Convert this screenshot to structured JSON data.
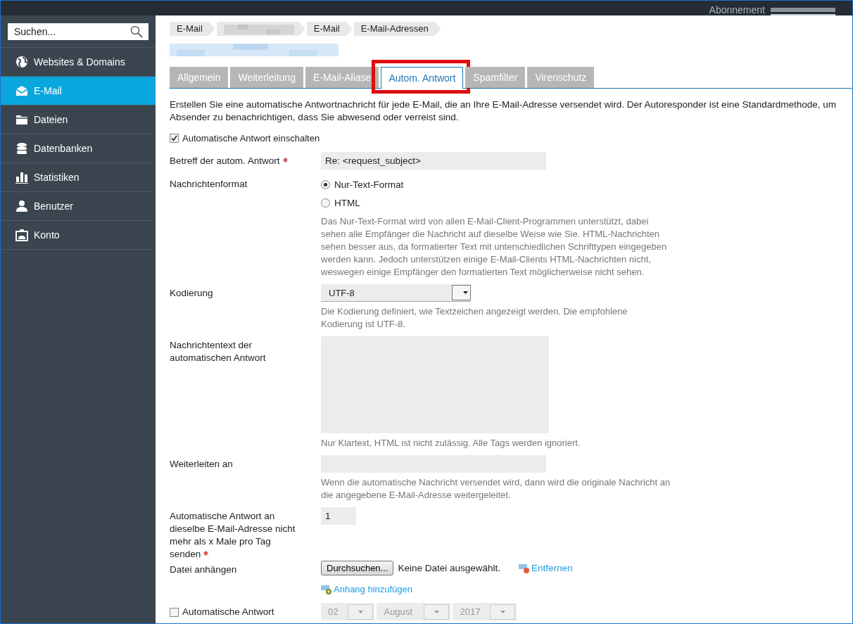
{
  "header": {
    "subscription_label": "Abonnement"
  },
  "sidebar": {
    "search": {
      "placeholder": "Suchen..."
    },
    "items": [
      {
        "label": "Websites & Domains",
        "selected": false
      },
      {
        "label": "E-Mail",
        "selected": true
      },
      {
        "label": "Dateien",
        "selected": false
      },
      {
        "label": "Datenbanken",
        "selected": false
      },
      {
        "label": "Statistiken",
        "selected": false
      },
      {
        "label": "Benutzer",
        "selected": false
      },
      {
        "label": "Konto",
        "selected": false
      }
    ]
  },
  "breadcrumbs": [
    {
      "kind": "text",
      "label": "E-Mail"
    },
    {
      "kind": "redacted"
    },
    {
      "kind": "text",
      "label": "E-Mail"
    },
    {
      "kind": "text",
      "label": "E-Mail-Adressen"
    }
  ],
  "tabs": [
    {
      "label": "Allgemein",
      "selected": false,
      "highlighted": false
    },
    {
      "label": "Weiterleitung",
      "selected": false,
      "highlighted": false
    },
    {
      "label": "E-Mail-Aliase",
      "selected": false,
      "highlighted": false
    },
    {
      "label": "Autom. Antwort",
      "selected": true,
      "highlighted": true
    },
    {
      "label": "Spamfilter",
      "selected": false,
      "highlighted": false
    },
    {
      "label": "Virenschutz",
      "selected": false,
      "highlighted": false
    }
  ],
  "intro": "Erstellen Sie eine automatische Antwortnachricht für jede E-Mail, die an Ihre E-Mail-Adresse versendet wird. Der Autoresponder ist eine Standardmethode, um Absender zu benachrichtigen, dass Sie abwesend oder verreist sind.",
  "enable": {
    "label": "Automatische Antwort einschalten",
    "checked": true
  },
  "fields": [
    {
      "kind": "text",
      "label": "Betreff der autom. Antwort",
      "required": true,
      "value": "Re: <request_subject>"
    },
    {
      "kind": "radio",
      "label": "Nachrichtenformat",
      "options": [
        {
          "label": "Nur-Text-Format",
          "selected": true
        },
        {
          "label": "HTML",
          "selected": false
        }
      ],
      "hint": "Das Nur-Text-Format wird von allen E-Mail-Client-Programmen unterstützt, dabei sehen alle Empfänger die Nachricht auf dieselbe Weise wie Sie. HTML-Nachrichten sehen besser aus, da formatierter Text mit unterschiedlichen Schrifttypen eingegeben werden kann. Jedoch unterstützen einige E-Mail-Clients HTML-Nachrichten nicht, weswegen einige Empfänger den formatierten Text möglicherweise nicht sehen."
    },
    {
      "kind": "select",
      "label": "Kodierung",
      "value": "UTF-8",
      "hint": "Die Kodierung definiert, wie Textzeichen angezeigt werden. Die empfohlene Kodierung ist UTF-8."
    },
    {
      "kind": "textarea",
      "label": "Nachrichtentext der automatischen Antwort",
      "hint": "Nur Klartext, HTML ist nicht zulässig. Alle Tags werden ignoriert."
    },
    {
      "kind": "text",
      "label": "Weiterleiten an",
      "hint": "Wenn die automatische Nachricht versendet wird, dann wird die originale Nachricht an die angegebene E-Mail-Adresse weitergeleitet."
    },
    {
      "kind": "number",
      "label": "Automatische Antwort an dieselbe E-Mail-Adresse nicht mehr als x Male pro Tag senden",
      "required": true,
      "value": "1"
    },
    {
      "kind": "file",
      "label": "Datei anhängen",
      "button": "Durchsuchen...",
      "status": "Keine Datei ausgewählt.",
      "remove": "Entfernen",
      "add": "Anhang hinzufügen"
    },
    {
      "kind": "date",
      "label": "Automatische Antwort",
      "checked": false,
      "disabled": true,
      "day": "02",
      "month": "August",
      "year": "2017"
    }
  ]
}
